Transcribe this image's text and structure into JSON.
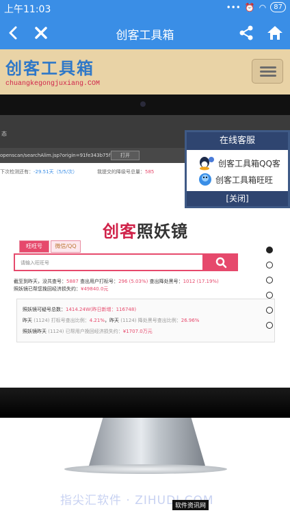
{
  "status_bar": {
    "time": "上午11:03",
    "battery": "87"
  },
  "app_bar": {
    "title": "创客工具箱"
  },
  "site": {
    "logo_text": "创客工具箱",
    "logo_url": "chuangkegongjuxiang.COM"
  },
  "screen": {
    "top_label": "态",
    "url_text": "openscan/searchAlim.jsp?origin=91fe343b75f77",
    "open_label": "打开",
    "line_left": "下次检测还有：",
    "line_left_value": "-29.51天（5/5/次）",
    "line_right": "我提交的降级号总量：",
    "line_right_value": "585",
    "brand_a": "创客",
    "brand_b": "照妖镜",
    "tab_active": "旺旺号",
    "tab_other": "微信/QQ",
    "search_placeholder": "请输入旺旺号",
    "stats_line1": "截至到昨天，没共查号：",
    "stats_line1_v1": "5887",
    "stats_line1_b": "查出用户打标号：",
    "stats_line1_v2": "296 (5.03%)",
    "stats_line1_c": "查出降处黑号：",
    "stats_line1_v3": "1012 (17.19%)",
    "stats_line2": "照妖镜已帮您挽回经济损失约：",
    "stats_line2_v": "¥49840.0元",
    "card_line1": "照妖镜可疑号总数：",
    "card_line1_v": "1414.24W(昨日新增：116748)",
    "card_line2a": "昨天",
    "card_line2b": "(1124) 打标号查出比例：",
    "card_line2_v1": "4.21%",
    "card_line2c": "，昨天",
    "card_line2d": "(1124) 降处黑号查出比例：",
    "card_line2_v2": "26.96%",
    "card_line3a": "照妖镜昨天",
    "card_line3b": "(1124) 已帮用户挽回经济损失约：",
    "card_line3_v": "¥1707.0万元"
  },
  "service": {
    "title": "在线客服",
    "item_qq": "创客工具箱QQ客",
    "item_ww": "创客工具箱旺旺",
    "close_label": "[关闭]"
  },
  "carousel": {
    "count": 6,
    "active_index": 0
  },
  "watermark": {
    "text": "指尖汇软件 · ZIHUDI.COM",
    "tag": "软件资讯网"
  },
  "colors": {
    "bar_blue": "#3a8ee6",
    "accent_pink": "#e6496c",
    "header_tan": "#e9d3a6",
    "service_navy": "#2f4570"
  },
  "icons": [
    "back-arrow-icon",
    "close-x-icon",
    "share-icon",
    "home-icon",
    "hamburger-menu-icon",
    "search-icon",
    "qq-penguin-icon",
    "wangwang-icon"
  ]
}
